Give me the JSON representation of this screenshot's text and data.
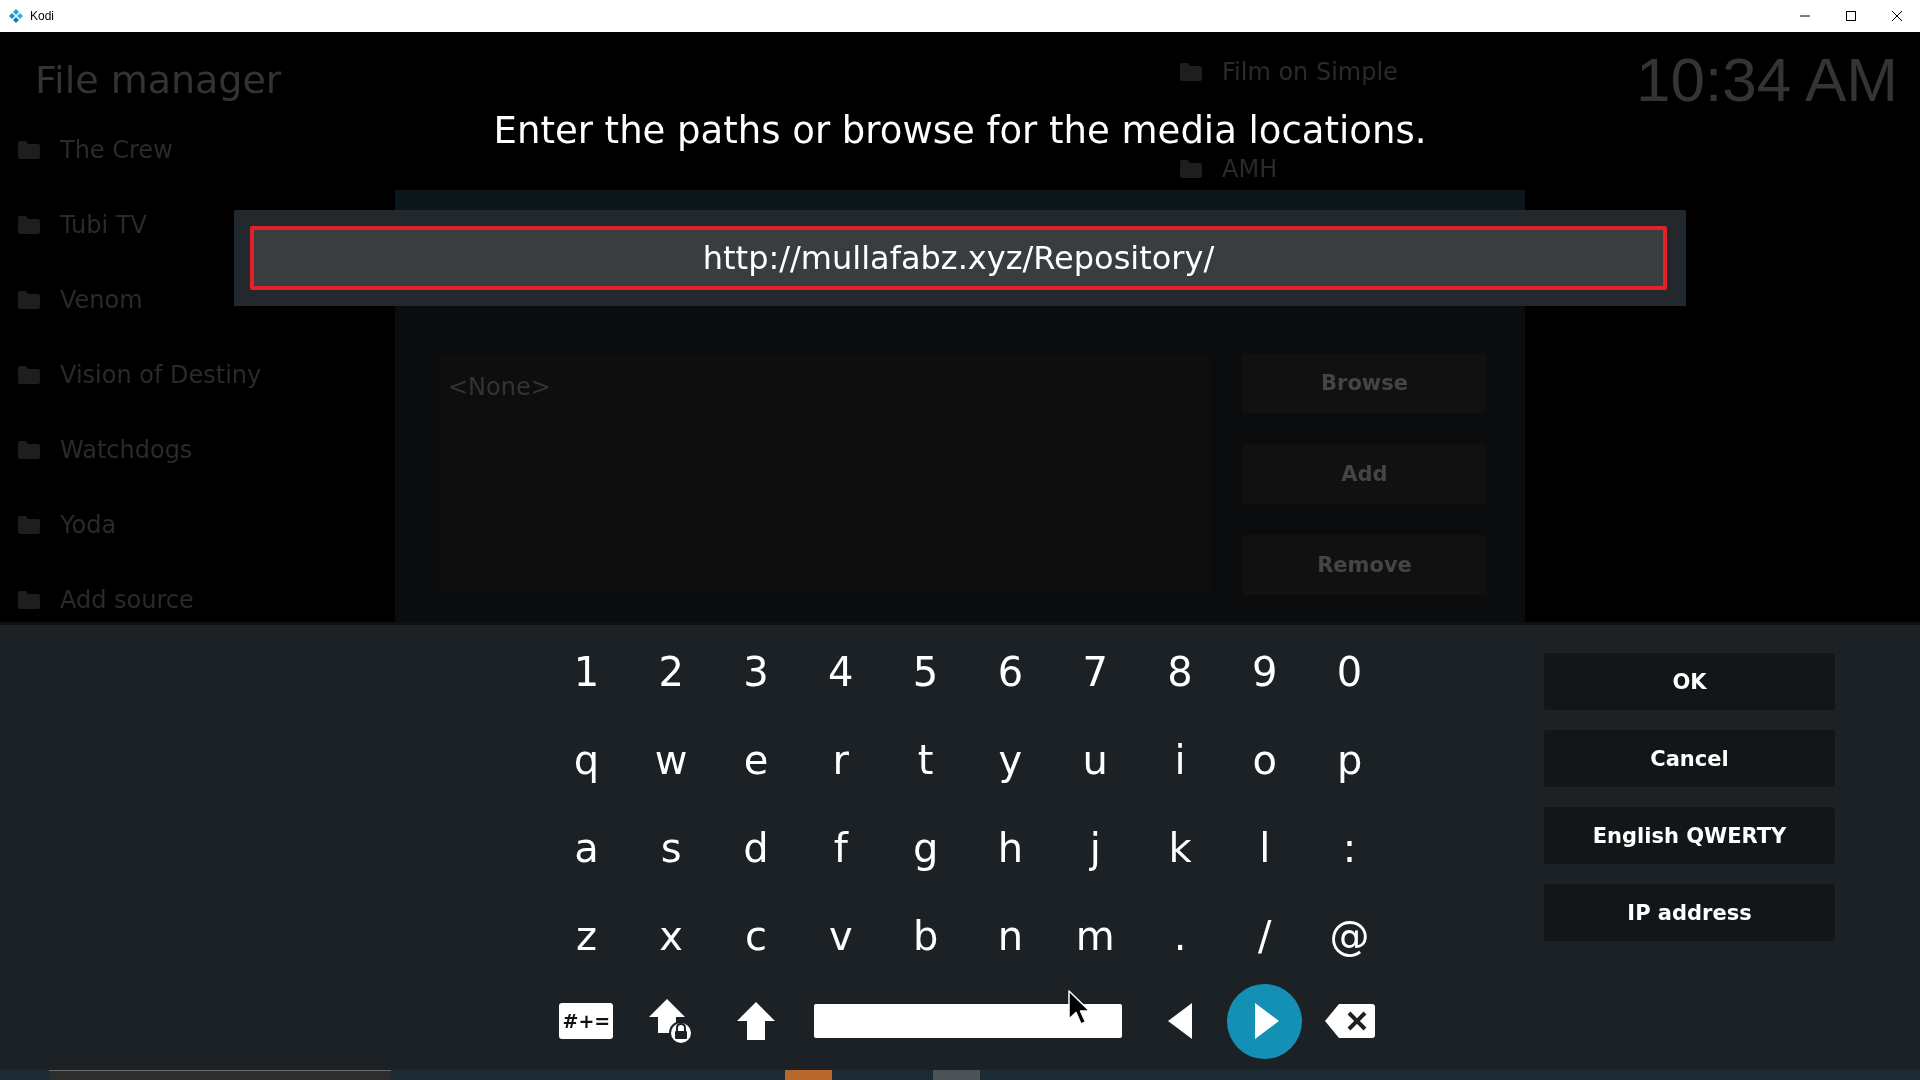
{
  "window": {
    "title": "Kodi"
  },
  "background": {
    "title": "File manager",
    "clock": "10:34 AM",
    "sources": [
      "The Crew",
      "Tubi TV",
      "Venom",
      "Vision of Destiny",
      "Watchdogs",
      "Yoda",
      "Add source"
    ],
    "sources_column_2": [
      "Film on Simple",
      "AMH"
    ],
    "dialog": {
      "paths_list": "<None>",
      "buttons": [
        "Browse",
        "Add",
        "Remove"
      ]
    }
  },
  "keyboard": {
    "heading": "Enter the paths or browse for the media locations.",
    "input": {
      "value": "http://mullafabz.xyz/Repository/"
    },
    "key_rows": [
      [
        "1",
        "2",
        "3",
        "4",
        "5",
        "6",
        "7",
        "8",
        "9",
        "0"
      ],
      [
        "q",
        "w",
        "e",
        "r",
        "t",
        "y",
        "u",
        "i",
        "o",
        "p"
      ],
      [
        "a",
        "s",
        "d",
        "f",
        "g",
        "h",
        "j",
        "k",
        "l",
        ":"
      ],
      [
        "z",
        "x",
        "c",
        "v",
        "b",
        "n",
        "m",
        ".",
        "/",
        "@"
      ]
    ],
    "bottom_keys": [
      {
        "kind": "symbols",
        "label": "#+=",
        "focused": false
      },
      {
        "kind": "caps_lock",
        "focused": false
      },
      {
        "kind": "shift",
        "focused": false
      },
      {
        "kind": "space",
        "focused": false
      },
      {
        "kind": "cursor_left",
        "focused": false
      },
      {
        "kind": "cursor_right",
        "focused": true
      },
      {
        "kind": "backspace",
        "focused": false
      }
    ],
    "buttons": [
      "OK",
      "Cancel",
      "English QWERTY",
      "IP address"
    ]
  }
}
